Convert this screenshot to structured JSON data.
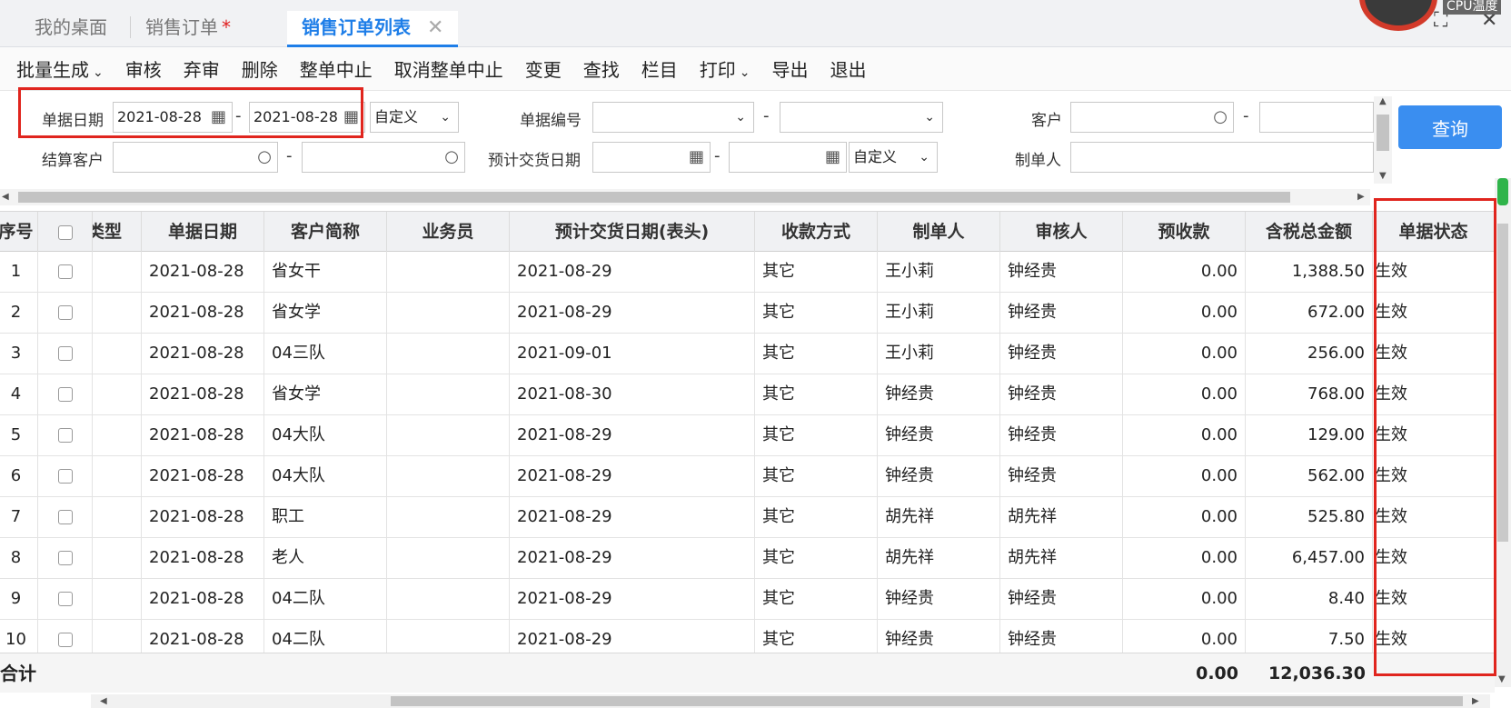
{
  "tabs": [
    {
      "label": "我的桌面",
      "active": false
    },
    {
      "label": "销售订单",
      "active": false,
      "dirty_mark": "*"
    },
    {
      "label": "销售订单列表",
      "active": true,
      "close_glyph": "✕"
    }
  ],
  "overlay": {
    "cpu_label": "CPU温度"
  },
  "toolbar": [
    {
      "label": "批量生成",
      "has_dropdown": true
    },
    {
      "label": "审核"
    },
    {
      "label": "弃审"
    },
    {
      "label": "删除"
    },
    {
      "label": "整单中止"
    },
    {
      "label": "取消整单中止"
    },
    {
      "label": "变更"
    },
    {
      "label": "查找"
    },
    {
      "label": "栏目"
    },
    {
      "label": "打印",
      "has_dropdown": true
    },
    {
      "label": "导出"
    },
    {
      "label": "退出"
    }
  ],
  "filter": {
    "bill_date_label": "单据日期",
    "bill_date_from": "2021-08-28",
    "bill_date_to": "2021-08-28",
    "bill_date_mode": "自定义",
    "bill_no_label": "单据编号",
    "bill_no_from": "",
    "bill_no_to": "",
    "customer_label": "客户",
    "customer_from": "",
    "customer_to": "",
    "settle_customer_label": "结算客户",
    "settle_customer_from": "",
    "settle_customer_to": "",
    "delivery_date_label": "预计交货日期",
    "delivery_date_from": "",
    "delivery_date_to": "",
    "delivery_date_mode": "自定义",
    "maker_label": "制单人",
    "maker_value": "",
    "range_dash": "-",
    "query_button": "查询"
  },
  "icons": {
    "calendar": "calendar-icon",
    "search": "search-icon",
    "dropdown": "chevron-down-icon"
  },
  "grid": {
    "columns": [
      "序号",
      "",
      "类型",
      "单据日期",
      "客户简称",
      "业务员",
      "预计交货日期(表头)",
      "收款方式",
      "制单人",
      "审核人",
      "预收款",
      "含税总金额",
      "单据状态"
    ],
    "rows": [
      {
        "no": "1",
        "date": "2021-08-28",
        "customer": "省女干",
        "sales": "",
        "delivery": "2021-08-29",
        "pay": "其它",
        "maker": "王小莉",
        "auditor": "钟经贵",
        "prepay": "0.00",
        "amount": "1,388.50",
        "status": "生效"
      },
      {
        "no": "2",
        "date": "2021-08-28",
        "customer": "省女学",
        "sales": "",
        "delivery": "2021-08-29",
        "pay": "其它",
        "maker": "王小莉",
        "auditor": "钟经贵",
        "prepay": "0.00",
        "amount": "672.00",
        "status": "生效"
      },
      {
        "no": "3",
        "date": "2021-08-28",
        "customer": "04三队",
        "sales": "",
        "delivery": "2021-09-01",
        "pay": "其它",
        "maker": "王小莉",
        "auditor": "钟经贵",
        "prepay": "0.00",
        "amount": "256.00",
        "status": "生效"
      },
      {
        "no": "4",
        "date": "2021-08-28",
        "customer": "省女学",
        "sales": "",
        "delivery": "2021-08-30",
        "pay": "其它",
        "maker": "钟经贵",
        "auditor": "钟经贵",
        "prepay": "0.00",
        "amount": "768.00",
        "status": "生效"
      },
      {
        "no": "5",
        "date": "2021-08-28",
        "customer": "04大队",
        "sales": "",
        "delivery": "2021-08-29",
        "pay": "其它",
        "maker": "钟经贵",
        "auditor": "钟经贵",
        "prepay": "0.00",
        "amount": "129.00",
        "status": "生效"
      },
      {
        "no": "6",
        "date": "2021-08-28",
        "customer": "04大队",
        "sales": "",
        "delivery": "2021-08-29",
        "pay": "其它",
        "maker": "钟经贵",
        "auditor": "钟经贵",
        "prepay": "0.00",
        "amount": "562.00",
        "status": "生效"
      },
      {
        "no": "7",
        "date": "2021-08-28",
        "customer": "职工",
        "sales": "",
        "delivery": "2021-08-29",
        "pay": "其它",
        "maker": "胡先祥",
        "auditor": "胡先祥",
        "prepay": "0.00",
        "amount": "525.80",
        "status": "生效"
      },
      {
        "no": "8",
        "date": "2021-08-28",
        "customer": "老人",
        "sales": "",
        "delivery": "2021-08-29",
        "pay": "其它",
        "maker": "胡先祥",
        "auditor": "胡先祥",
        "prepay": "0.00",
        "amount": "6,457.00",
        "status": "生效"
      },
      {
        "no": "9",
        "date": "2021-08-28",
        "customer": "04二队",
        "sales": "",
        "delivery": "2021-08-29",
        "pay": "其它",
        "maker": "钟经贵",
        "auditor": "钟经贵",
        "prepay": "0.00",
        "amount": "8.40",
        "status": "生效"
      },
      {
        "no": "10",
        "date": "2021-08-28",
        "customer": "04二队",
        "sales": "",
        "delivery": "2021-08-29",
        "pay": "其它",
        "maker": "钟经贵",
        "auditor": "钟经贵",
        "prepay": "0.00",
        "amount": "7.50",
        "status": "生效"
      }
    ],
    "total": {
      "label": "合计",
      "prepay": "0.00",
      "amount": "12,036.30"
    }
  },
  "colors": {
    "accent": "#1e7ee8",
    "highlight": "#e0251e",
    "query_button": "#3a8ef0"
  }
}
